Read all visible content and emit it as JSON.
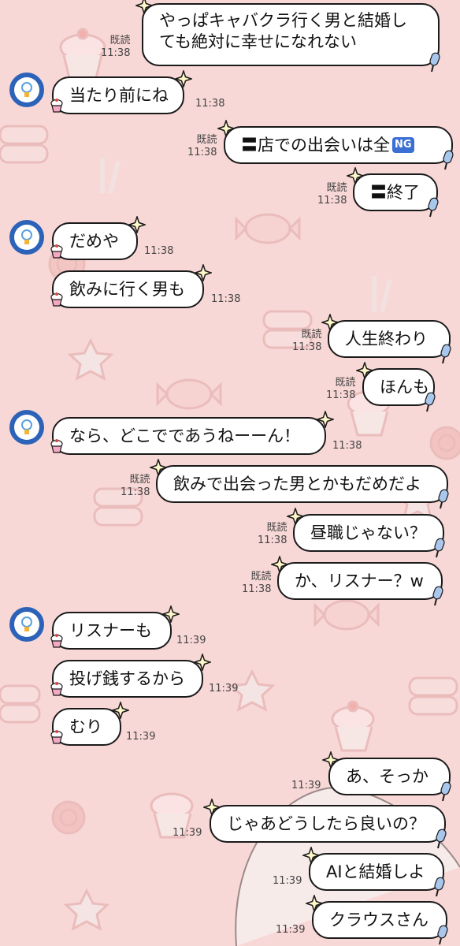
{
  "read_label": "既読",
  "messages": [
    {
      "side": "right",
      "text": "やっぱキャバクラ行く男と結婚しても絶対に幸せになれない",
      "time": "11:38",
      "read": true
    },
    {
      "side": "left",
      "avatar": true,
      "text": "当たり前にね",
      "time": "11:38"
    },
    {
      "side": "right",
      "text": "〓店での出会いは全",
      "badge": "NG",
      "time": "11:38",
      "read": true
    },
    {
      "side": "right",
      "text": "〓終了",
      "time": "11:38",
      "read": true
    },
    {
      "side": "left",
      "avatar": true,
      "text": "だめや",
      "time": "11:38"
    },
    {
      "side": "left",
      "text": "飲みに行く男も",
      "time": "11:38"
    },
    {
      "side": "right",
      "text": "人生終わり",
      "time": "11:38",
      "read": true
    },
    {
      "side": "right",
      "text": "ほんも",
      "time": "11:38",
      "read": true
    },
    {
      "side": "left",
      "avatar": true,
      "text": "なら、どこでであうねーーん！",
      "time": "11:38"
    },
    {
      "side": "right",
      "text": "飲みで出会った男とかもだめだよ",
      "time": "11:38",
      "read": true
    },
    {
      "side": "right",
      "text": "昼職じゃない？",
      "time": "11:38",
      "read": true
    },
    {
      "side": "right",
      "text": "か、リスナー？w",
      "time": "11:38",
      "read": true
    },
    {
      "side": "left",
      "avatar": true,
      "text": "リスナーも",
      "time": "11:39"
    },
    {
      "side": "left",
      "text": "投げ銭するから",
      "time": "11:39"
    },
    {
      "side": "left",
      "text": "むり",
      "time": "11:39"
    },
    {
      "side": "right",
      "text": "あ、そっか",
      "time": "11:39"
    },
    {
      "side": "right",
      "text": "じゃあどうしたら良いの？",
      "time": "11:39"
    },
    {
      "side": "right",
      "text": "AIと結婚しよ",
      "time": "11:39"
    },
    {
      "side": "right",
      "text": "クラウスさん",
      "time": "11:39"
    }
  ],
  "colors": {
    "background": "#f8d8d6",
    "bubble": "#ffffff",
    "outline": "#1a1a1a",
    "avatar": "#2c63b9",
    "ng_badge": "#3b6fd3"
  }
}
